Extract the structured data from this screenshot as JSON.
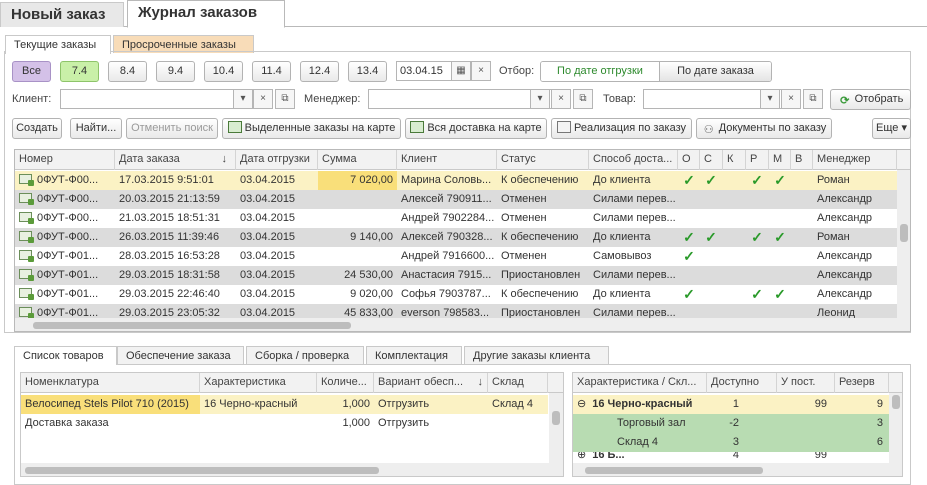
{
  "top_tabs": {
    "new_order": "Новый заказ",
    "journal": "Журнал заказов"
  },
  "sub_tabs": {
    "current": "Текущие заказы",
    "overdue": "Просроченные заказы"
  },
  "date_buttons": [
    "Все",
    "7.4",
    "8.4",
    "9.4",
    "10.4",
    "11.4",
    "12.4",
    "13.4"
  ],
  "date_field": {
    "value": "03.04.15"
  },
  "filter": {
    "label": "Отбор:",
    "by_ship": "По дате отгрузки",
    "by_order": "По дате заказа"
  },
  "client_label": "Клиент:",
  "manager_label": "Менеджер:",
  "product_label": "Товар:",
  "select_button": "Отобрать",
  "toolbar": {
    "create": "Создать",
    "find": "Найти...",
    "cancel_search": "Отменить поиск",
    "selected_on_map": "Выделенные заказы на карте",
    "all_delivery_map": "Вся доставка на карте",
    "realization": "Реализация по заказу",
    "documents": "Документы по заказу",
    "more": "Еще"
  },
  "columns": [
    "Номер",
    "Дата заказа",
    "Дата отгрузки",
    "Сумма",
    "Клиент",
    "Статус",
    "Способ доста...",
    "О",
    "С",
    "К",
    "Р",
    "М",
    "В",
    "Менеджер"
  ],
  "orders": [
    {
      "num": "0ФУТ-Ф00...",
      "date": "17.03.2015 9:51:01",
      "ship": "03.04.2015",
      "sum": "7 020,00",
      "client": "Марина Соловь...",
      "status": "К обеспечению",
      "delivery": "До клиента",
      "o": "✓",
      "s": "✓",
      "k": "",
      "r": "✓",
      "m": "✓",
      "v": "",
      "manager": "Роман"
    },
    {
      "num": "0ФУТ-Ф00...",
      "date": "20.03.2015 21:13:59",
      "ship": "03.04.2015",
      "sum": "",
      "client": "Алексей 790911...",
      "status": "Отменен",
      "delivery": "Силами перев...",
      "o": "",
      "s": "",
      "k": "",
      "r": "",
      "m": "",
      "v": "",
      "manager": "Александр"
    },
    {
      "num": "0ФУТ-Ф00...",
      "date": "21.03.2015 18:51:31",
      "ship": "03.04.2015",
      "sum": "",
      "client": "Андрей 7902284...",
      "status": "Отменен",
      "delivery": "Силами перев...",
      "o": "",
      "s": "",
      "k": "",
      "r": "",
      "m": "",
      "v": "",
      "manager": "Александр"
    },
    {
      "num": "0ФУТ-Ф00...",
      "date": "26.03.2015 11:39:46",
      "ship": "03.04.2015",
      "sum": "9 140,00",
      "client": "Алексей 790328...",
      "status": "К обеспечению",
      "delivery": "До клиента",
      "o": "✓",
      "s": "✓",
      "k": "",
      "r": "✓",
      "m": "✓",
      "v": "",
      "manager": "Роман"
    },
    {
      "num": "0ФУТ-Ф01...",
      "date": "28.03.2015 16:53:28",
      "ship": "03.04.2015",
      "sum": "",
      "client": "Андрей 7916600...",
      "status": "Отменен",
      "delivery": "Самовывоз",
      "o": "✓",
      "s": "",
      "k": "",
      "r": "",
      "m": "",
      "v": "",
      "manager": "Александр"
    },
    {
      "num": "0ФУТ-Ф01...",
      "date": "29.03.2015 18:31:58",
      "ship": "03.04.2015",
      "sum": "24 530,00",
      "client": "Анастасия 7915...",
      "status": "Приостановлен",
      "delivery": "Силами перев...",
      "o": "",
      "s": "",
      "k": "",
      "r": "",
      "m": "",
      "v": "",
      "manager": "Александр"
    },
    {
      "num": "0ФУТ-Ф01...",
      "date": "29.03.2015 22:46:40",
      "ship": "03.04.2015",
      "sum": "9 020,00",
      "client": "Софья 7903787...",
      "status": "К обеспечению",
      "delivery": "До клиента",
      "o": "✓",
      "s": "",
      "k": "",
      "r": "✓",
      "m": "✓",
      "v": "",
      "manager": "Александр"
    },
    {
      "num": "0ФУТ-Ф01...",
      "date": "29.03.2015 23:05:32",
      "ship": "03.04.2015",
      "sum": "45 833,00",
      "client": "everson 798583...",
      "status": "Приостановлен",
      "delivery": "Силами перев...",
      "o": "",
      "s": "",
      "k": "",
      "r": "",
      "m": "",
      "v": "",
      "manager": "Леонид"
    }
  ],
  "bottom_tabs": [
    "Список товаров",
    "Обеспечение заказа",
    "Сборка / проверка",
    "Комплектация",
    "Другие заказы клиента"
  ],
  "items_columns": [
    "Номенклатура",
    "Характеристика",
    "Количе...",
    "Вариант обесп...",
    "Склад"
  ],
  "items": [
    {
      "name": "Велосипед Stels Pilot 710 (2015)",
      "char": "16 Черно-красный",
      "qty": "1,000",
      "variant": "Отгрузить",
      "stock": "Склад 4"
    },
    {
      "name": "Доставка заказа",
      "char": "",
      "qty": "1,000",
      "variant": "Отгрузить",
      "stock": ""
    }
  ],
  "stock_columns": [
    "Характеристика / Скл...",
    "Доступно",
    "У пост.",
    "Резерв"
  ],
  "stock": [
    {
      "name": "16 Черно-красный",
      "avail": "1",
      "post": "99",
      "reserve": "9"
    },
    {
      "name": "Торговый зал",
      "avail": "-2",
      "post": "",
      "reserve": "3"
    },
    {
      "name": "Склад 4",
      "avail": "3",
      "post": "",
      "reserve": "6"
    },
    {
      "name": "16 Б...",
      "avail": "4",
      "post": "99",
      "reserve": ""
    }
  ]
}
